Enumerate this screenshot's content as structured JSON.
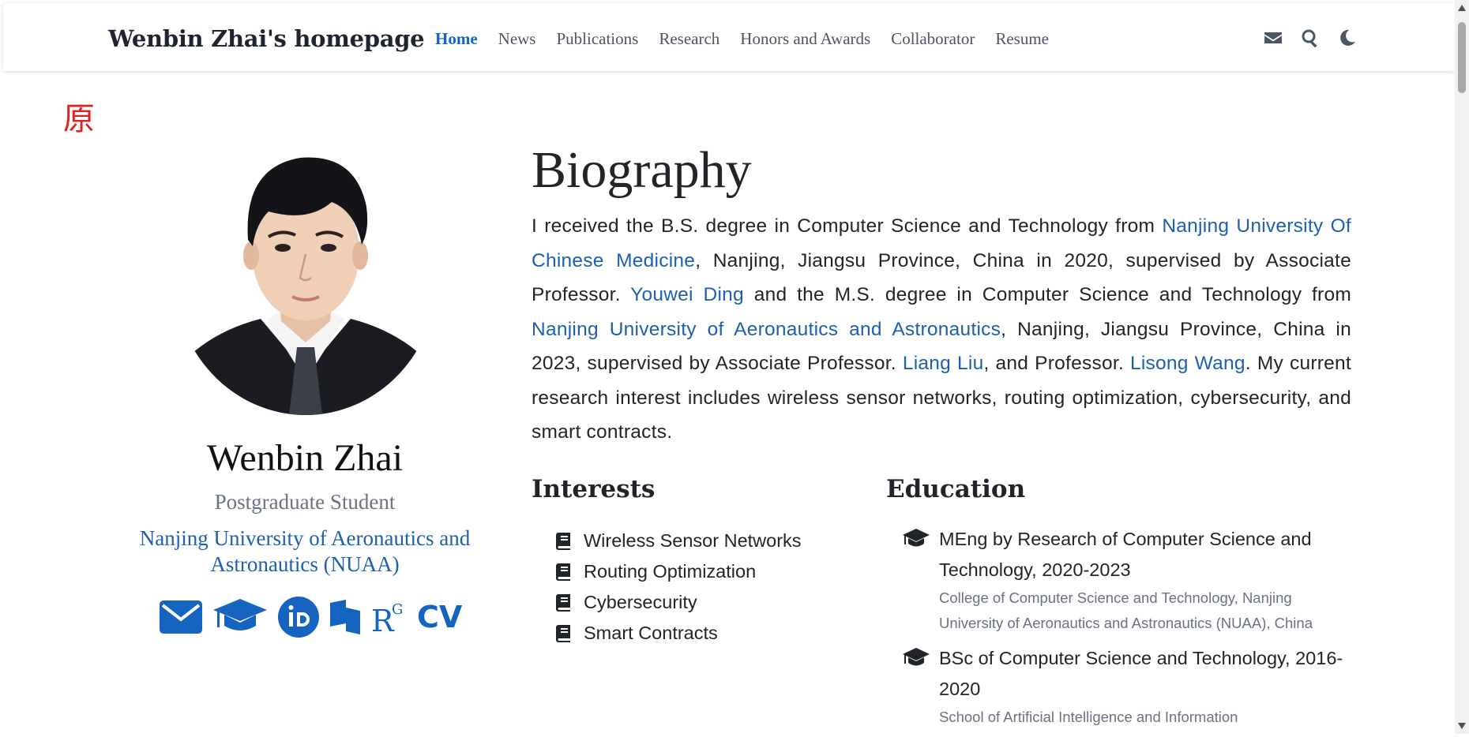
{
  "navbar": {
    "brand": "Wenbin Zhai's homepage",
    "links": [
      {
        "label": "Home",
        "active": true
      },
      {
        "label": "News"
      },
      {
        "label": "Publications"
      },
      {
        "label": "Research"
      },
      {
        "label": "Honors and Awards"
      },
      {
        "label": "Collaborator"
      },
      {
        "label": "Resume"
      }
    ],
    "icons": [
      "envelope-icon",
      "search-icon",
      "moon-icon"
    ]
  },
  "corner_glyph": "原",
  "profile": {
    "name": "Wenbin Zhai",
    "role": "Postgraduate Student",
    "organization": "Nanjing University of Aeronautics and Astronautics (NUAA)",
    "social_icons": [
      "email-icon",
      "graduation-cap-icon",
      "orcid-icon",
      "dblp-icon",
      "researchgate-icon",
      "cv-icon"
    ],
    "cv_label": "CV"
  },
  "biography": {
    "title": "Biography",
    "segments": [
      {
        "text": "I received the B.S. degree in Computer Science and Technology from "
      },
      {
        "text": "Nanjing University Of Chinese Medicine",
        "link": true
      },
      {
        "text": ", Nanjing, Jiangsu Province, China in 2020, supervised by Associate Professor. "
      },
      {
        "text": "Youwei Ding",
        "link": true
      },
      {
        "text": " and the M.S. degree in Computer Science and Technology from "
      },
      {
        "text": "Nanjing University of Aeronautics and Astronautics",
        "link": true
      },
      {
        "text": ", Nanjing, Jiangsu Province, China in 2023, supervised by Associate Professor. "
      },
      {
        "text": "Liang Liu",
        "link": true
      },
      {
        "text": ", and Professor. "
      },
      {
        "text": "Lisong Wang",
        "link": true
      },
      {
        "text": ". My current research interest includes wireless sensor networks, routing optimization, cybersecurity, and smart contracts."
      }
    ]
  },
  "interests": {
    "title": "Interests",
    "items": [
      "Wireless Sensor Networks",
      "Routing Optimization",
      "Cybersecurity",
      "Smart Contracts"
    ]
  },
  "education": {
    "title": "Education",
    "items": [
      {
        "degree": "MEng by Research of Computer Science and Technology, 2020-2023",
        "institution": "College of Computer Science and Technology, Nanjing University of Aeronautics and Astronautics (NUAA), China"
      },
      {
        "degree": "BSc of Computer Science and Technology, 2016-2020",
        "institution": "School of Artificial Intelligence and Information"
      }
    ]
  }
}
